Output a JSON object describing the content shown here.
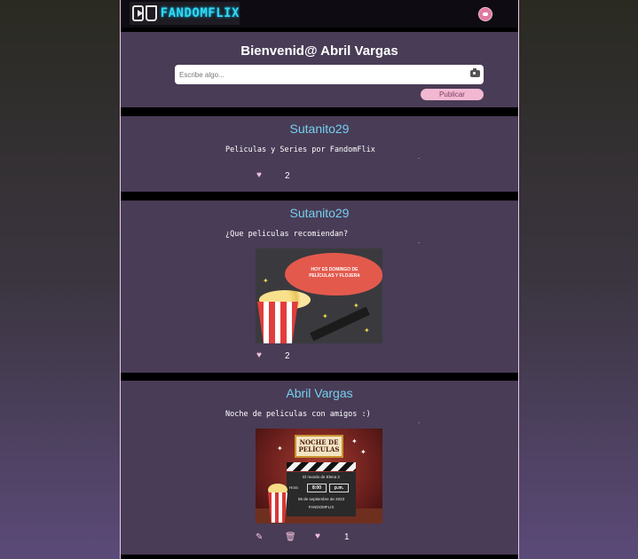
{
  "navbar": {
    "logo_text": "FANDOMFLIX"
  },
  "welcome": {
    "title": "Bienvenid@ Abril Vargas",
    "input_placeholder": "Escribe algo...",
    "publish_label": "Publicar"
  },
  "posts": [
    {
      "user": "Sutanito29",
      "text": "Peliculas y Series por FandomFlix",
      "likes": "2"
    },
    {
      "user": "Sutanito29",
      "text": "¿Que peliculas recomiendan?",
      "likes": "2",
      "image_text": "HOY ES DOMINGO DE PELÍCULAS Y FLOJERA"
    },
    {
      "user": "Abril Vargas",
      "text": "Noche de peliculas con amigos :)",
      "likes": "1",
      "image": {
        "sign": "NOCHE DE PELÍCULAS",
        "subtitle": "El mundo de Elena 2",
        "hora_label": "Hora",
        "hora": "8:00",
        "pm": "p.m.",
        "date": "09 de septiembre de 2023",
        "brand": "FANDOMFLIX"
      }
    }
  ],
  "colors": {
    "card_bg": "#493c56",
    "username": "#74d0f0",
    "accent_pink": "#f2b8d2",
    "logo_cyan": "#34d9ee"
  },
  "icons": [
    "camera-icon",
    "heart-icon",
    "edit-icon",
    "trash-icon",
    "avatar"
  ]
}
